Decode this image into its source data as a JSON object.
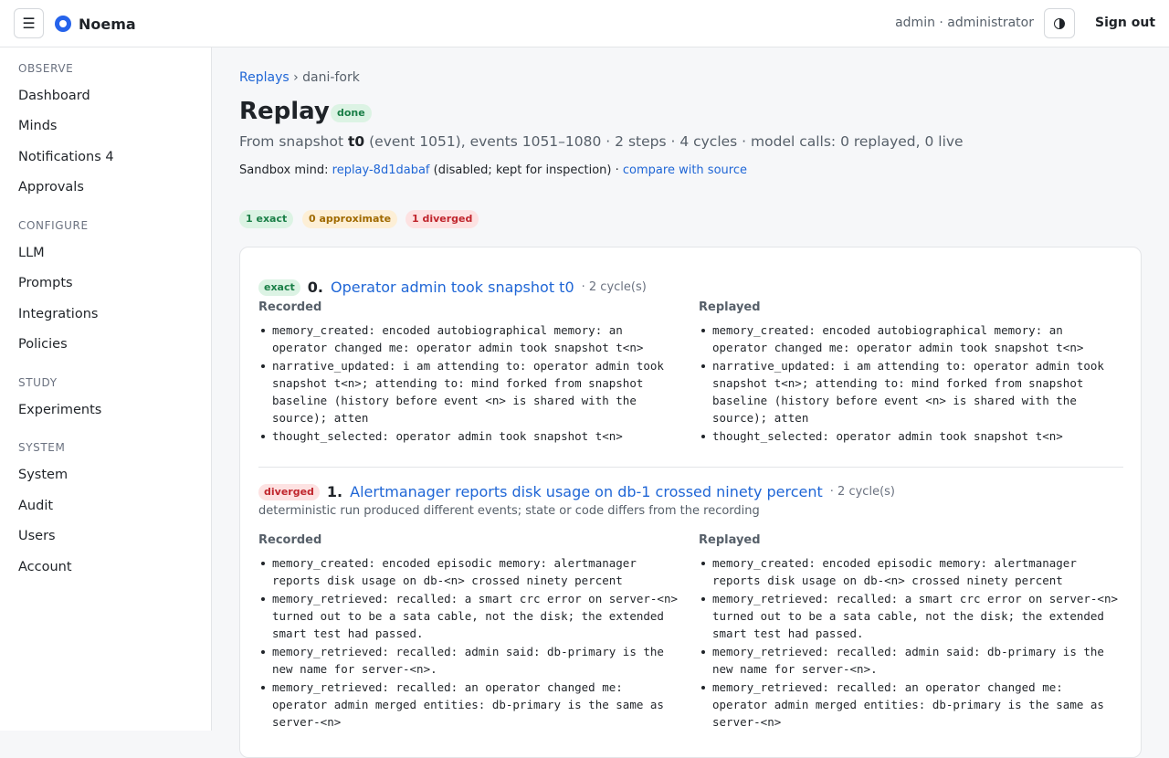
{
  "app": {
    "name": "Noema",
    "menu_glyph": "☰",
    "user": "admin · administrator",
    "sign_out": "Sign out"
  },
  "sidebar": {
    "sections": [
      {
        "label": "OBSERVE",
        "items": [
          {
            "label": "Dashboard"
          },
          {
            "label": "Minds"
          },
          {
            "label": "Notifications 4"
          },
          {
            "label": "Approvals"
          }
        ]
      },
      {
        "label": "CONFIGURE",
        "items": [
          {
            "label": "LLM"
          },
          {
            "label": "Prompts"
          },
          {
            "label": "Integrations"
          },
          {
            "label": "Policies"
          }
        ]
      },
      {
        "label": "STUDY",
        "items": [
          {
            "label": "Experiments"
          }
        ]
      },
      {
        "label": "SYSTEM",
        "items": [
          {
            "label": "System"
          },
          {
            "label": "Audit"
          },
          {
            "label": "Users"
          },
          {
            "label": "Account"
          }
        ]
      }
    ]
  },
  "breadcrumb": {
    "parent": "Replays",
    "sep": "›",
    "current": "dani-fork"
  },
  "page": {
    "title": "Replay",
    "status": "done",
    "summary_prefix": "From snapshot",
    "summary_snapshot": "t0",
    "summary_rest": "(event 1051), events 1051–1080 · 2 steps · 4 cycles · model calls: 0 replayed, 0 live",
    "sandbox_label": "Sandbox mind:",
    "sandbox_link": "replay-8d1dabaf",
    "sandbox_note": "(disabled; kept for inspection) ·",
    "compare_link": "compare with source"
  },
  "counts": {
    "exact": "1 exact",
    "approximate": "0 approximate",
    "diverged": "1 diverged"
  },
  "steps": [
    {
      "tag": "exact",
      "num": "0.",
      "title": "Operator admin took snapshot t0",
      "cycles": "· 2 cycle(s)",
      "recorded_label": "Recorded",
      "replayed_label": "Replayed",
      "recorded": [
        "memory_created: encoded autobiographical memory: an operator changed me: operator admin took snapshot t<n>",
        "narrative_updated: i am attending to: operator admin took snapshot t<n>; attending to: mind forked from snapshot baseline (history before event <n> is shared with the source); atten",
        "thought_selected: operator admin took snapshot t<n>"
      ],
      "replayed": [
        "memory_created: encoded autobiographical memory: an operator changed me: operator admin took snapshot t<n>",
        "narrative_updated: i am attending to: operator admin took snapshot t<n>; attending to: mind forked from snapshot baseline (history before event <n> is shared with the source); atten",
        "thought_selected: operator admin took snapshot t<n>"
      ]
    },
    {
      "tag": "diverged",
      "num": "1.",
      "title": "Alertmanager reports disk usage on db-1 crossed ninety percent",
      "cycles": "· 2 cycle(s)",
      "note": "deterministic run produced different events; state or code differs from the recording",
      "recorded_label": "Recorded",
      "replayed_label": "Replayed",
      "recorded": [
        "memory_created: encoded episodic memory: alertmanager reports disk usage on db-<n> crossed ninety percent",
        "memory_retrieved: recalled: a smart crc error on server-<n> turned out to be a sata cable, not the disk; the extended smart test had passed.",
        "memory_retrieved: recalled: admin said: db-primary is the new name for server-<n>.",
        "memory_retrieved: recalled: an operator changed me: operator admin merged entities: db-primary is the same as server-<n>"
      ],
      "replayed": [
        "memory_created: encoded episodic memory: alertmanager reports disk usage on db-<n> crossed ninety percent",
        "memory_retrieved: recalled: a smart crc error on server-<n> turned out to be a sata cable, not the disk; the extended smart test had passed.",
        "memory_retrieved: recalled: admin said: db-primary is the new name for server-<n>.",
        "memory_retrieved: recalled: an operator changed me: operator admin merged entities: db-primary is the same as server-<n>"
      ]
    }
  ]
}
